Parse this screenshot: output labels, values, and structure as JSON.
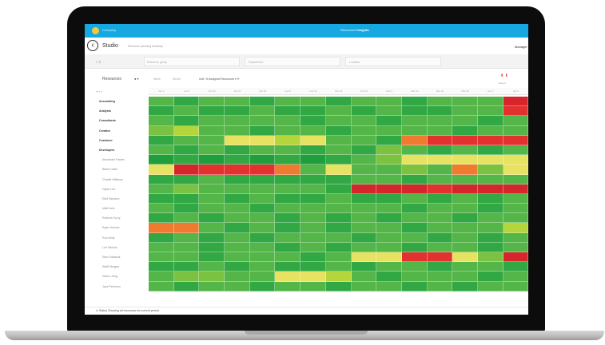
{
  "app": {
    "org_label": "Company",
    "nav_prefix": "Resources",
    "nav_current": "Insights"
  },
  "header": {
    "title": "Studio",
    "subtitle": "Resource planning heatmap",
    "user": "Manager"
  },
  "filters": {
    "left_mini": "≡  ⚲",
    "boxes": [
      {
        "label": "Resource group"
      },
      {
        "label": "Department"
      },
      {
        "label": "Location"
      }
    ]
  },
  "toolbar": {
    "title": "Resources",
    "selector": "● ▾",
    "tabs": [
      "Week",
      "Month"
    ],
    "view_label": "Unit: % Assigned Resources  ▾  ⟳",
    "icons": "⬆  ⬇",
    "icon_label": "Export"
  },
  "grid": {
    "controls": "+  ‹  ›",
    "columns": [
      "Jan 1",
      "Jan 8",
      "Jan 15",
      "Jan 22",
      "Jan 29",
      "Feb 5",
      "Feb 12",
      "Feb 19",
      "Feb 26",
      "Mar 5",
      "Mar 12",
      "Mar 19",
      "Mar 26",
      "Apr 2",
      "Apr 9"
    ],
    "rows": [
      {
        "label": "Accounting",
        "kind": "grp",
        "cells": [
          "g3",
          "g2",
          "g3",
          "g3",
          "g2",
          "g3",
          "g3",
          "g2",
          "g3",
          "g3",
          "g2",
          "g3",
          "g3",
          "g3",
          "dr"
        ]
      },
      {
        "label": "Analysts",
        "kind": "grp",
        "cells": [
          "g2",
          "g3",
          "g2",
          "g2",
          "g3",
          "g2",
          "g2",
          "g3",
          "g2",
          "g3",
          "g2",
          "g2",
          "g3",
          "g3",
          "r"
        ]
      },
      {
        "label": "Consultants",
        "kind": "grp",
        "cells": [
          "g3",
          "g2",
          "g3",
          "g3",
          "g3",
          "g3",
          "g2",
          "g3",
          "g3",
          "g2",
          "g3",
          "g3",
          "g3",
          "g2",
          "g3"
        ]
      },
      {
        "label": "Creative",
        "kind": "grp",
        "cells": [
          "g4",
          "yg",
          "g3",
          "g3",
          "g2",
          "g3",
          "g3",
          "g2",
          "g3",
          "g3",
          "g3",
          "g3",
          "g2",
          "g3",
          "g3"
        ]
      },
      {
        "label": "Customer",
        "kind": "grp",
        "cells": [
          "g2",
          "g3",
          "g3",
          "y",
          "y",
          "yg",
          "y",
          "g3",
          "g3",
          "g2",
          "o",
          "r",
          "r",
          "r",
          "r"
        ]
      },
      {
        "label": "Developers",
        "kind": "grp",
        "cells": [
          "g3",
          "g2",
          "g3",
          "g2",
          "g3",
          "g3",
          "g2",
          "g3",
          "g2",
          "g4",
          "g3",
          "g2",
          "g3",
          "g2",
          "g3"
        ]
      },
      {
        "label": "Alexander Parker",
        "kind": "sub",
        "cells": [
          "g1",
          "g2",
          "g1",
          "g2",
          "g1",
          "g2",
          "g1",
          "g2",
          "g3",
          "g4",
          "y",
          "y",
          "y",
          "y",
          "y"
        ]
      },
      {
        "label": "Blake Hollis",
        "kind": "sub",
        "cells": [
          "y",
          "dr",
          "r",
          "r",
          "r",
          "o",
          "g3",
          "y",
          "g3",
          "g3",
          "g4",
          "g3",
          "o",
          "g4",
          "y"
        ]
      },
      {
        "label": "Charlie Williams",
        "kind": "sub",
        "cells": [
          "g2",
          "g2",
          "g3",
          "g2",
          "g2",
          "g2",
          "g2",
          "g2",
          "g3",
          "g3",
          "g2",
          "g3",
          "g3",
          "g3",
          "g3"
        ]
      },
      {
        "label": "Dylan Lee",
        "kind": "sub",
        "cells": [
          "g3",
          "g4",
          "g3",
          "g3",
          "g3",
          "g3",
          "g3",
          "g2",
          "dr",
          "dr",
          "dr",
          "r",
          "dr",
          "dr",
          "dr"
        ]
      },
      {
        "label": "Eliot Sanders",
        "kind": "sub",
        "cells": [
          "g2",
          "g2",
          "g3",
          "g2",
          "g3",
          "g2",
          "g2",
          "g3",
          "g2",
          "g2",
          "g3",
          "g2",
          "g3",
          "g2",
          "g3"
        ]
      },
      {
        "label": "Matt Irwin",
        "kind": "sub",
        "cells": [
          "g3",
          "g2",
          "g3",
          "g3",
          "g2",
          "g3",
          "g3",
          "g3",
          "g3",
          "g3",
          "g2",
          "g3",
          "g3",
          "g2",
          "g3"
        ]
      },
      {
        "label": "Roberto Curry",
        "kind": "sub",
        "cells": [
          "g2",
          "g3",
          "g2",
          "g3",
          "g3",
          "g2",
          "g3",
          "g2",
          "g3",
          "g2",
          "g3",
          "g3",
          "g2",
          "g3",
          "g3"
        ]
      },
      {
        "label": "Ryan Holmes",
        "kind": "sub",
        "cells": [
          "o",
          "o",
          "g3",
          "g2",
          "g3",
          "g2",
          "g3",
          "g2",
          "g3",
          "g3",
          "g2",
          "g3",
          "g3",
          "g3",
          "yg"
        ]
      },
      {
        "label": "Ron Kelly",
        "kind": "sub",
        "cells": [
          "g2",
          "g3",
          "g2",
          "g3",
          "g2",
          "g3",
          "g3",
          "g3",
          "g2",
          "g3",
          "g3",
          "g2",
          "g3",
          "g2",
          "g3"
        ]
      },
      {
        "label": "Lori Nichols",
        "kind": "sub",
        "cells": [
          "g3",
          "g3",
          "g2",
          "g3",
          "g3",
          "g2",
          "g3",
          "g2",
          "g3",
          "g3",
          "g2",
          "g3",
          "g3",
          "g2",
          "g3"
        ]
      },
      {
        "label": "Sam Edwards",
        "kind": "sub",
        "cells": [
          "g3",
          "g3",
          "g2",
          "g3",
          "g3",
          "g3",
          "g2",
          "g3",
          "y",
          "y",
          "r",
          "r",
          "y",
          "g4",
          "dr"
        ]
      },
      {
        "label": "Steffi Morgan",
        "kind": "sub",
        "cells": [
          "g2",
          "g2",
          "g3",
          "g2",
          "g3",
          "g2",
          "g2",
          "g3",
          "g2",
          "g3",
          "g3",
          "g2",
          "g3",
          "g3",
          "g2"
        ]
      },
      {
        "label": "Vance Jung",
        "kind": "sub",
        "cells": [
          "g3",
          "g4",
          "g4",
          "g3",
          "g3",
          "y",
          "y",
          "yg",
          "g3",
          "g2",
          "g3",
          "g3",
          "g3",
          "g2",
          "g3"
        ]
      },
      {
        "label": "Jack Peterson",
        "kind": "sub",
        "cells": [
          "g3",
          "g2",
          "g3",
          "g3",
          "g2",
          "g3",
          "g3",
          "g2",
          "g3",
          "g3",
          "g2",
          "g3",
          "g2",
          "g3",
          "g3"
        ]
      }
    ]
  },
  "footer": {
    "text": "⊙ Status  Showing all resources for current period"
  }
}
